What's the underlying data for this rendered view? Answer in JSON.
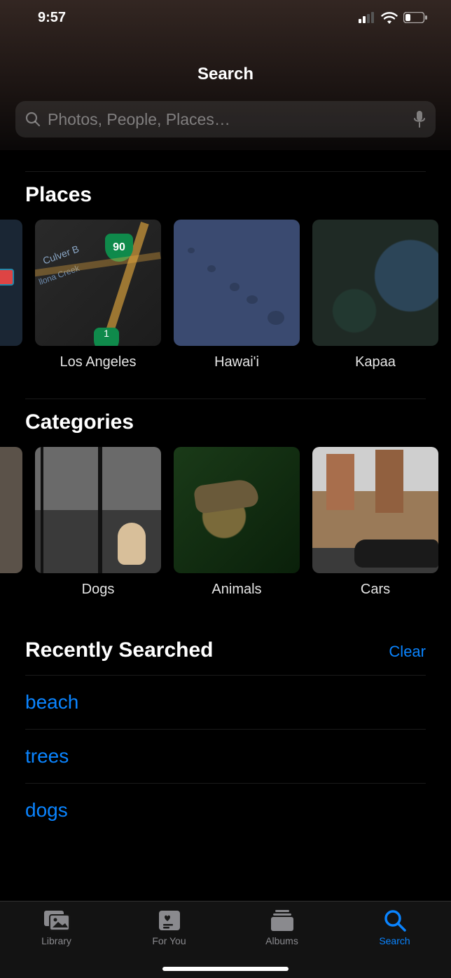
{
  "status": {
    "time": "9:57",
    "signal_icon": "cellular-signal-icon",
    "wifi_icon": "wifi-icon",
    "battery_icon": "battery-low-icon"
  },
  "header": {
    "title": "Search"
  },
  "search": {
    "placeholder": "Photos, People, Places…",
    "value": "",
    "left_icon": "search-icon",
    "right_icon": "microphone-icon"
  },
  "places": {
    "title": "Places",
    "items": [
      {
        "label": "Los Angeles",
        "route_badge": "90",
        "subtext": "Culver B",
        "creek": "llona Creek"
      },
      {
        "label": "Hawai'i"
      },
      {
        "label": "Kapaa"
      }
    ]
  },
  "categories": {
    "title": "Categories",
    "items": [
      {
        "label": "Dogs"
      },
      {
        "label": "Animals"
      },
      {
        "label": "Cars"
      }
    ]
  },
  "recent": {
    "title": "Recently Searched",
    "clear_label": "Clear",
    "items": [
      "beach",
      "trees",
      "dogs"
    ]
  },
  "tabbar": {
    "items": [
      {
        "label": "Library",
        "icon": "photo-library-icon",
        "active": false
      },
      {
        "label": "For You",
        "icon": "for-you-icon",
        "active": false
      },
      {
        "label": "Albums",
        "icon": "albums-icon",
        "active": false
      },
      {
        "label": "Search",
        "icon": "search-icon",
        "active": true
      }
    ]
  },
  "colors": {
    "accent": "#0a84ff",
    "background": "#000000",
    "secondary_text": "#8a8a8e"
  }
}
